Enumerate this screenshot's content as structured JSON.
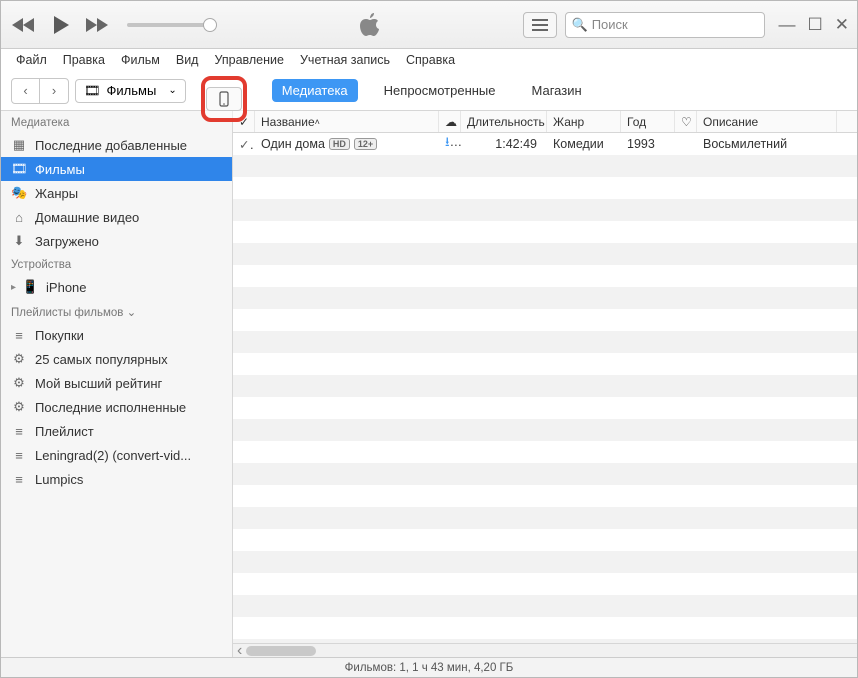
{
  "search": {
    "placeholder": "Поиск"
  },
  "menu": [
    "Файл",
    "Правка",
    "Фильм",
    "Вид",
    "Управление",
    "Учетная запись",
    "Справка"
  ],
  "category": {
    "label": "Фильмы"
  },
  "tabs": [
    {
      "label": "Медиатека",
      "active": true
    },
    {
      "label": "Непросмотренные"
    },
    {
      "label": "Магазин"
    }
  ],
  "sidebar": {
    "sections": [
      {
        "header": "Медиатека",
        "items": [
          {
            "icon": "grid",
            "label": "Последние добавленные"
          },
          {
            "icon": "film",
            "label": "Фильмы",
            "selected": true
          },
          {
            "icon": "masks",
            "label": "Жанры"
          },
          {
            "icon": "home",
            "label": "Домашние видео"
          },
          {
            "icon": "download",
            "label": "Загружено"
          }
        ]
      },
      {
        "header": "Устройства",
        "items": [
          {
            "icon": "phone",
            "label": "iPhone",
            "caret": true
          }
        ]
      },
      {
        "header": "Плейлисты фильмов ⌄",
        "items": [
          {
            "icon": "list",
            "label": "Покупки"
          },
          {
            "icon": "gear",
            "label": "25 самых популярных"
          },
          {
            "icon": "gear",
            "label": "Мой высший рейтинг"
          },
          {
            "icon": "gear",
            "label": "Последние исполненные"
          },
          {
            "icon": "list",
            "label": "Плейлист"
          },
          {
            "icon": "list",
            "label": "Leningrad(2)  (convert-vid..."
          },
          {
            "icon": "list",
            "label": "Lumpics"
          }
        ]
      }
    ]
  },
  "columns": [
    {
      "key": "chk",
      "label": "✓",
      "w": 22
    },
    {
      "key": "name",
      "label": "Название",
      "w": 184,
      "sort": "asc"
    },
    {
      "key": "cloud",
      "label": "",
      "w": 22,
      "icon": "cloud"
    },
    {
      "key": "dur",
      "label": "Длительность",
      "w": 86
    },
    {
      "key": "genre",
      "label": "Жанр",
      "w": 74
    },
    {
      "key": "year",
      "label": "Год",
      "w": 54
    },
    {
      "key": "heart",
      "label": "",
      "w": 22,
      "icon": "heart"
    },
    {
      "key": "desc",
      "label": "Описание",
      "w": 140
    }
  ],
  "rows": [
    {
      "chk": "✓",
      "name": "Один дома",
      "badges": [
        "HD",
        "12+"
      ],
      "cloud": "dl",
      "dur": "1:42:49",
      "genre": "Комедии",
      "year": "1993",
      "desc": "Восьмилетний"
    }
  ],
  "status": "Фильмов: 1, 1 ч 43 мин, 4,20 ГБ"
}
